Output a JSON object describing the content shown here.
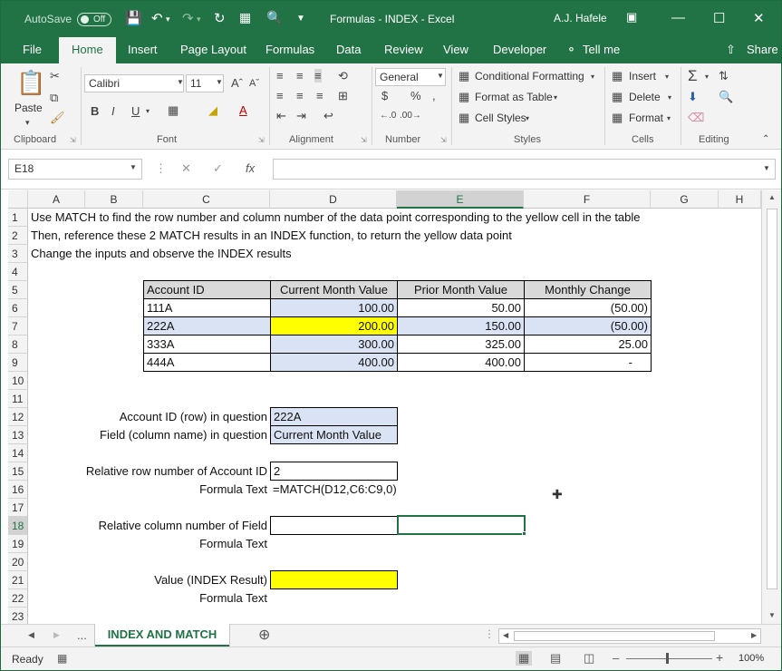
{
  "titlebar": {
    "autosave_label": "AutoSave",
    "autosave_state": "Off",
    "title": "Formulas - INDEX  -  Excel",
    "user": "A.J. Hafele"
  },
  "tabs": [
    "File",
    "Home",
    "Insert",
    "Page Layout",
    "Formulas",
    "Data",
    "Review",
    "View",
    "Developer",
    "Tell me",
    "Share"
  ],
  "ribbon": {
    "paste": "Paste",
    "font_name": "Calibri",
    "font_size": "11",
    "number_format": "General",
    "conditional_formatting": "Conditional Formatting",
    "format_as_table": "Format as Table",
    "cell_styles": "Cell Styles",
    "insert": "Insert",
    "delete": "Delete",
    "format": "Format",
    "groups": [
      "Clipboard",
      "Font",
      "Alignment",
      "Number",
      "Styles",
      "Cells",
      "Editing"
    ]
  },
  "formula_bar": {
    "name_box": "E18",
    "formula": ""
  },
  "columns": [
    "A",
    "B",
    "C",
    "D",
    "E",
    "F",
    "G",
    "H"
  ],
  "rows": [
    "1",
    "2",
    "3",
    "4",
    "5",
    "6",
    "7",
    "8",
    "9",
    "10",
    "11",
    "12",
    "13",
    "14",
    "15",
    "16",
    "17",
    "18",
    "19",
    "20",
    "21",
    "22",
    "23"
  ],
  "sheet": {
    "line1": "Use MATCH to find the row number and column number of the data point corresponding to the yellow cell in the table",
    "line2": "Then, reference these 2 MATCH results in an INDEX function, to return the yellow data point",
    "line3": "Change the inputs and observe the INDEX results",
    "table": {
      "headers": [
        "Account ID",
        "Current Month Value",
        "Prior Month Value",
        "Monthly Change"
      ],
      "rows": [
        [
          "111A",
          "100.00",
          "50.00",
          "(50.00)"
        ],
        [
          "222A",
          "200.00",
          "150.00",
          "(50.00)"
        ],
        [
          "333A",
          "300.00",
          "325.00",
          "25.00"
        ],
        [
          "444A",
          "400.00",
          "400.00",
          "-"
        ]
      ]
    },
    "account_label": "Account ID (row) in question",
    "account_value": "222A",
    "field_label": "Field (column name) in question",
    "field_value": "Current Month Value",
    "rel_row_label": "Relative row number of Account ID",
    "rel_row_value": "2",
    "formula_text_label": "Formula Text",
    "rel_row_formula": "=MATCH(D12,C6:C9,0)",
    "rel_col_label": "Relative column number of Field",
    "value_label": "Value (INDEX Result)"
  },
  "sheet_tab": "INDEX AND MATCH",
  "sheet_tab_more": "...",
  "status": {
    "ready": "Ready",
    "zoom": "100%"
  }
}
